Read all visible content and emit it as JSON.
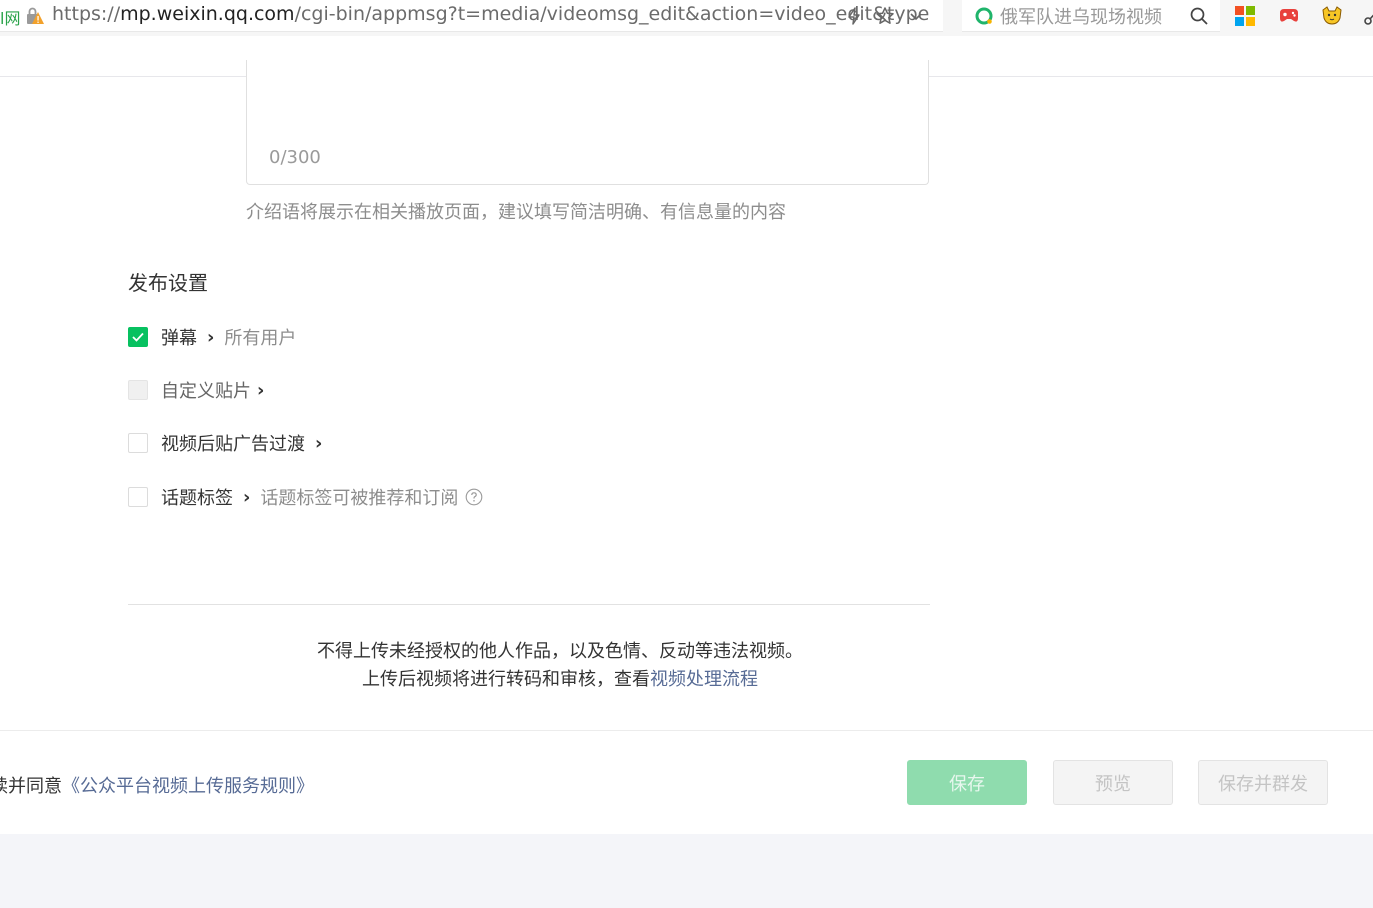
{
  "browser": {
    "site_tag": "l网",
    "url_scheme": "https://",
    "url_domain": "mp.weixin.qq.com",
    "url_path": "/cgi-bin/appmsg?t=media/videomsg_edit&action=video_edit&type",
    "search_text": "俄军队进乌现场视频"
  },
  "intro": {
    "counter": "0/300",
    "hint": "介绍语将展示在相关播放页面，建议填写简洁明确、有信息量的内容"
  },
  "publish_settings": {
    "title": "发布设置",
    "options": [
      {
        "label": "弹幕",
        "value": "所有用户",
        "checked": true
      },
      {
        "label": "自定义贴片",
        "checked": false,
        "disabled": true
      },
      {
        "label": "视频后贴广告过渡",
        "checked": false
      },
      {
        "label": "话题标签",
        "value": "话题标签可被推荐和订阅",
        "checked": false
      }
    ]
  },
  "notice": {
    "line1": "不得上传未经授权的他人作品，以及色情、反动等违法视频。",
    "line2_prefix": "上传后视频将进行转码和审核，查看",
    "line2_link": "视频处理流程"
  },
  "footer": {
    "agree_prefix": "读并同意",
    "agree_link": "《公众平台视频上传服务规则》",
    "save_label": "保存",
    "preview_label": "预览",
    "save_send_label": "保存并群发"
  },
  "colors": {
    "primary": "#07c160",
    "link": "#576b95"
  }
}
